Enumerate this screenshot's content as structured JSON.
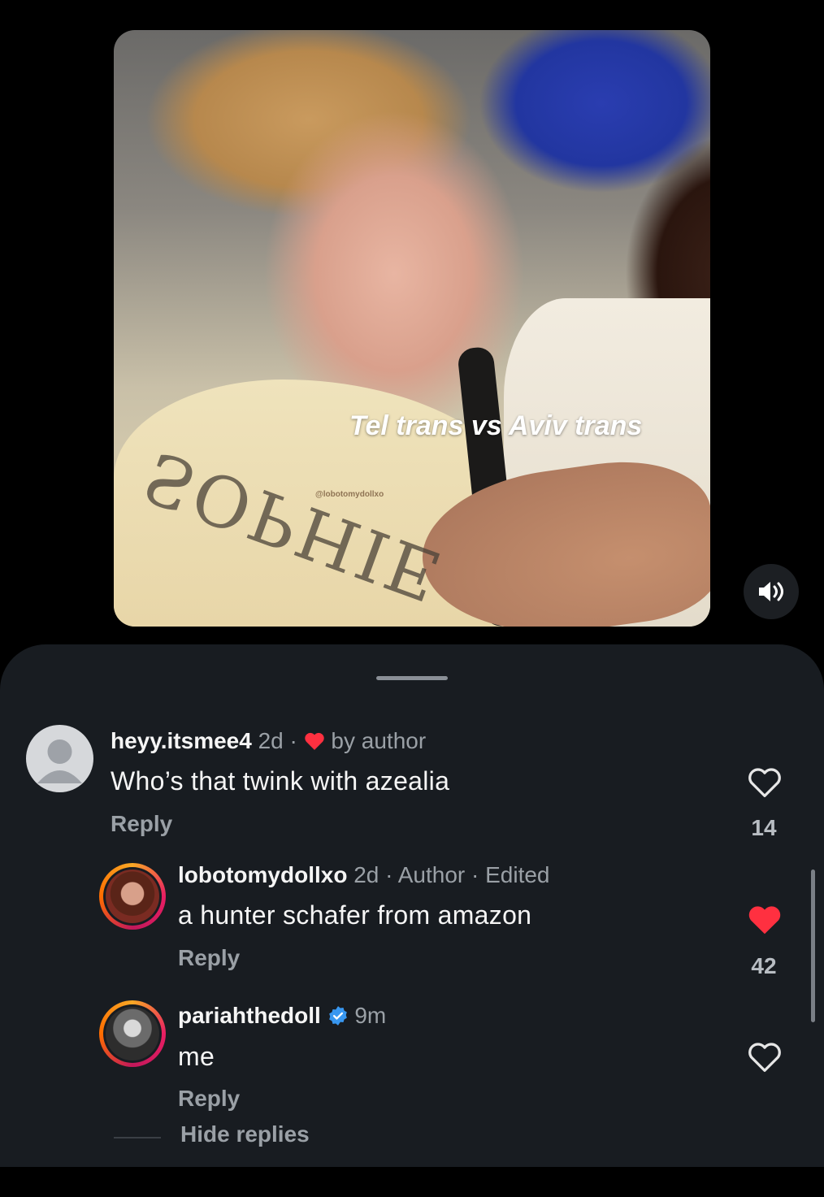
{
  "video": {
    "overlay_caption": "Tel trans vs Aviv trans",
    "watermark": "@lobotomydollxo",
    "shirt_text": "SOPHIE",
    "sound_icon": "speaker-on-icon"
  },
  "comments": [
    {
      "username": "heyy.itsmee4",
      "time": "2d",
      "separator": "·",
      "badge": "by author",
      "badge_icon": "heart-filled-icon",
      "text": "Who’s that twink with azealia",
      "reply_label": "Reply",
      "likes": "14",
      "liked": false
    },
    {
      "username": "lobotomydollxo",
      "time": "2d",
      "author_label": "Author",
      "edited_label": "Edited",
      "separator": "·",
      "text": "a hunter schafer from amazon",
      "reply_label": "Reply",
      "likes": "42",
      "liked": true
    },
    {
      "username": "pariahthedoll",
      "verified": true,
      "time": "9m",
      "text": "me",
      "reply_label": "Reply",
      "likes": "",
      "liked": false
    }
  ],
  "hide_replies_label": "Hide replies",
  "colors": {
    "sheet_bg": "#181c21",
    "like_red": "#ff3040",
    "verified_blue": "#3897f0",
    "muted": "#9aa0a6"
  }
}
